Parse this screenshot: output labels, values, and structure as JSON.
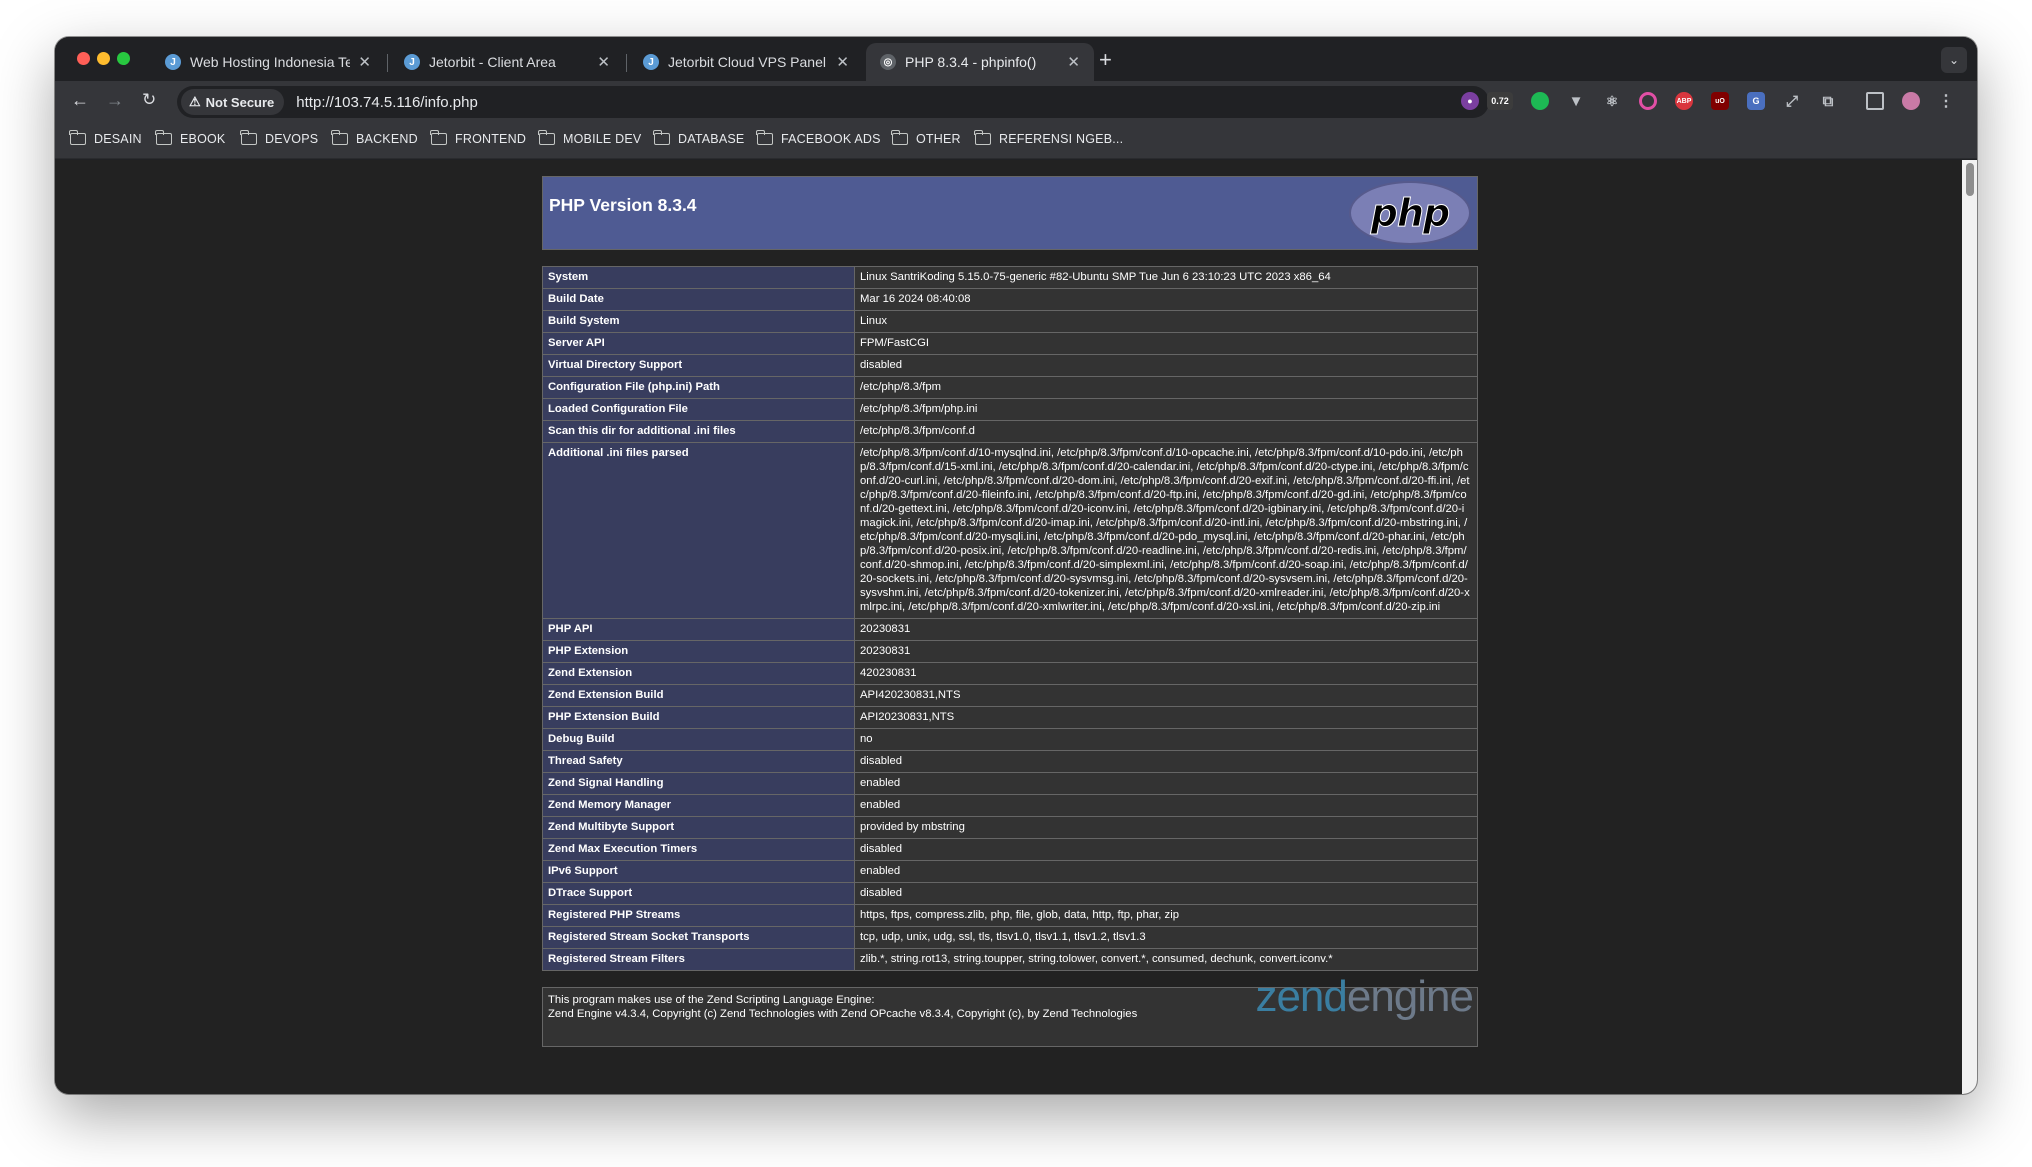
{
  "browser": {
    "tabs": [
      {
        "title": "Web Hosting Indonesia Terbaik",
        "icon": "jetorbit-favicon"
      },
      {
        "title": "Jetorbit - Client Area",
        "icon": "jetorbit-favicon"
      },
      {
        "title": "Jetorbit Cloud VPS Panel",
        "icon": "jetorbit-favicon"
      },
      {
        "title": "PHP 8.3.4 - phpinfo()",
        "icon": "globe-favicon"
      }
    ],
    "security_label": "Not Secure",
    "url": "http://103.74.5.116/info.php",
    "extension_badge": "0.72",
    "bookmarks": [
      "DESAIN",
      "EBOOK",
      "DEVOPS",
      "BACKEND",
      "FRONTEND",
      "MOBILE DEV",
      "DATABASE",
      "FACEBOOK ADS",
      "OTHER",
      "REFERENSI NGEB..."
    ]
  },
  "phpinfo": {
    "title": "PHP Version 8.3.4",
    "logo_text": "php",
    "rows": [
      {
        "k": "System",
        "v": "Linux SantriKoding 5.15.0-75-generic #82-Ubuntu SMP Tue Jun 6 23:10:23 UTC 2023 x86_64"
      },
      {
        "k": "Build Date",
        "v": "Mar 16 2024 08:40:08"
      },
      {
        "k": "Build System",
        "v": "Linux"
      },
      {
        "k": "Server API",
        "v": "FPM/FastCGI"
      },
      {
        "k": "Virtual Directory Support",
        "v": "disabled"
      },
      {
        "k": "Configuration File (php.ini) Path",
        "v": "/etc/php/8.3/fpm"
      },
      {
        "k": "Loaded Configuration File",
        "v": "/etc/php/8.3/fpm/php.ini"
      },
      {
        "k": "Scan this dir for additional .ini files",
        "v": "/etc/php/8.3/fpm/conf.d"
      },
      {
        "k": "Additional .ini files parsed",
        "v": "/etc/php/8.3/fpm/conf.d/10-mysqlnd.ini, /etc/php/8.3/fpm/conf.d/10-opcache.ini, /etc/php/8.3/fpm/conf.d/10-pdo.ini, /etc/php/8.3/fpm/conf.d/15-xml.ini, /etc/php/8.3/fpm/conf.d/20-calendar.ini, /etc/php/8.3/fpm/conf.d/20-ctype.ini, /etc/php/8.3/fpm/conf.d/20-curl.ini, /etc/php/8.3/fpm/conf.d/20-dom.ini, /etc/php/8.3/fpm/conf.d/20-exif.ini, /etc/php/8.3/fpm/conf.d/20-ffi.ini, /etc/php/8.3/fpm/conf.d/20-fileinfo.ini, /etc/php/8.3/fpm/conf.d/20-ftp.ini, /etc/php/8.3/fpm/conf.d/20-gd.ini, /etc/php/8.3/fpm/conf.d/20-gettext.ini, /etc/php/8.3/fpm/conf.d/20-iconv.ini, /etc/php/8.3/fpm/conf.d/20-igbinary.ini, /etc/php/8.3/fpm/conf.d/20-imagick.ini, /etc/php/8.3/fpm/conf.d/20-imap.ini, /etc/php/8.3/fpm/conf.d/20-intl.ini, /etc/php/8.3/fpm/conf.d/20-mbstring.ini, /etc/php/8.3/fpm/conf.d/20-mysqli.ini, /etc/php/8.3/fpm/conf.d/20-pdo_mysql.ini, /etc/php/8.3/fpm/conf.d/20-phar.ini, /etc/php/8.3/fpm/conf.d/20-posix.ini, /etc/php/8.3/fpm/conf.d/20-readline.ini, /etc/php/8.3/fpm/conf.d/20-redis.ini, /etc/php/8.3/fpm/conf.d/20-shmop.ini, /etc/php/8.3/fpm/conf.d/20-simplexml.ini, /etc/php/8.3/fpm/conf.d/20-soap.ini, /etc/php/8.3/fpm/conf.d/20-sockets.ini, /etc/php/8.3/fpm/conf.d/20-sysvmsg.ini, /etc/php/8.3/fpm/conf.d/20-sysvsem.ini, /etc/php/8.3/fpm/conf.d/20-sysvshm.ini, /etc/php/8.3/fpm/conf.d/20-tokenizer.ini, /etc/php/8.3/fpm/conf.d/20-xmlreader.ini, /etc/php/8.3/fpm/conf.d/20-xmlrpc.ini, /etc/php/8.3/fpm/conf.d/20-xmlwriter.ini, /etc/php/8.3/fpm/conf.d/20-xsl.ini, /etc/php/8.3/fpm/conf.d/20-zip.ini"
      },
      {
        "k": "PHP API",
        "v": "20230831"
      },
      {
        "k": "PHP Extension",
        "v": "20230831"
      },
      {
        "k": "Zend Extension",
        "v": "420230831"
      },
      {
        "k": "Zend Extension Build",
        "v": "API420230831,NTS"
      },
      {
        "k": "PHP Extension Build",
        "v": "API20230831,NTS"
      },
      {
        "k": "Debug Build",
        "v": "no"
      },
      {
        "k": "Thread Safety",
        "v": "disabled"
      },
      {
        "k": "Zend Signal Handling",
        "v": "enabled"
      },
      {
        "k": "Zend Memory Manager",
        "v": "enabled"
      },
      {
        "k": "Zend Multibyte Support",
        "v": "provided by mbstring"
      },
      {
        "k": "Zend Max Execution Timers",
        "v": "disabled"
      },
      {
        "k": "IPv6 Support",
        "v": "enabled"
      },
      {
        "k": "DTrace Support",
        "v": "disabled"
      },
      {
        "k": "Registered PHP Streams",
        "v": "https, ftps, compress.zlib, php, file, glob, data, http, ftp, phar, zip"
      },
      {
        "k": "Registered Stream Socket Transports",
        "v": "tcp, udp, unix, udg, ssl, tls, tlsv1.0, tlsv1.1, tlsv1.2, tlsv1.3"
      },
      {
        "k": "Registered Stream Filters",
        "v": "zlib.*, string.rot13, string.toupper, string.tolower, convert.*, consumed, dechunk, convert.iconv.*"
      }
    ],
    "footer_line1": "This program makes use of the Zend Scripting Language Engine:",
    "footer_line2": "Zend Engine v4.3.4, Copyright (c) Zend Technologies with Zend OPcache v8.3.4, Copyright (c), by Zend Technologies",
    "zend_logo_a": "zend",
    "zend_logo_b": "engine"
  }
}
